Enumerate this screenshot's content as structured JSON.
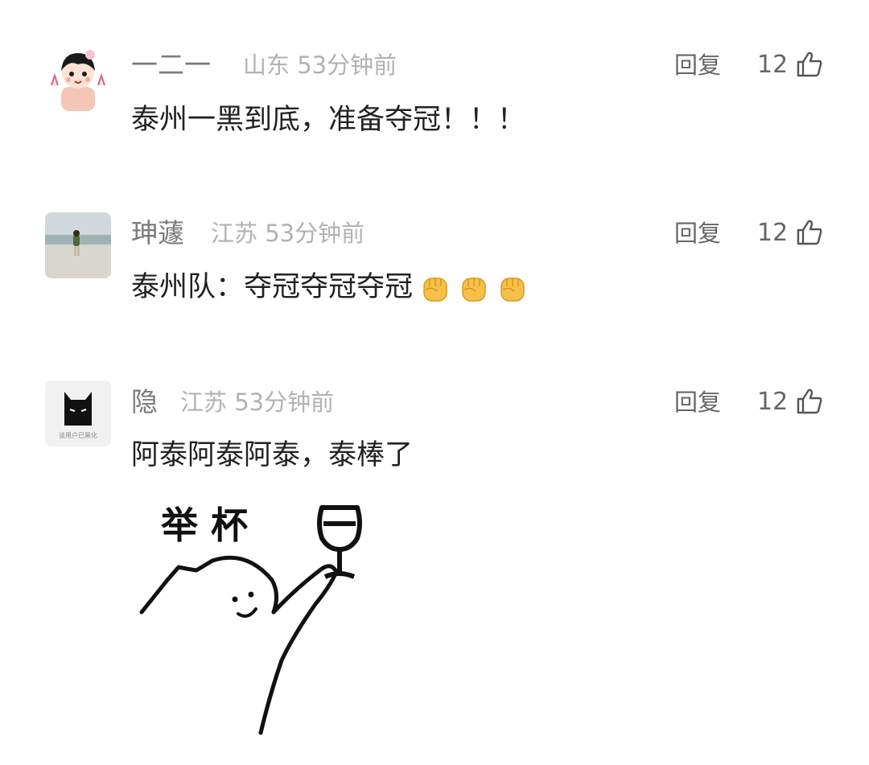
{
  "comments": [
    {
      "name": "一二一",
      "location": "山东",
      "time": "53分钟前",
      "reply_label": "回复",
      "likes": "12",
      "text": "泰州一黑到底，准备夺冠！！！"
    },
    {
      "name": "珅蘧",
      "location": "江苏",
      "time": "53分钟前",
      "reply_label": "回复",
      "likes": "12",
      "text": "泰州队：夺冠夺冠夺冠",
      "emoji_icons": [
        "raised-fist-icon",
        "raised-fist-icon",
        "raised-fist-icon"
      ]
    },
    {
      "name": "隐",
      "location": "江苏",
      "time": "53分钟前",
      "reply_label": "回复",
      "likes": "12",
      "text": "阿泰阿泰阿泰，泰棒了",
      "avatar_caption": "该用户已黑化",
      "sticker_caption": "举 杯"
    }
  ],
  "colors": {
    "name": "#7b7b7b",
    "meta": "#b2b2b2",
    "body_text": "#222222",
    "action": "#666666",
    "emoji": "#f7c04a"
  }
}
